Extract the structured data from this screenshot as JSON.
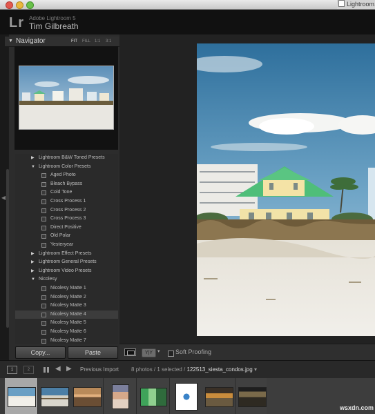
{
  "window": {
    "title": "Lightroom.lr"
  },
  "identity": {
    "logo": "Lr",
    "product": "Adobe Lightroom 5",
    "user": "Tim Gilbreath"
  },
  "navigator": {
    "title": "Navigator",
    "zoom_options": [
      "FIT",
      "FILL",
      "1:1",
      "3:1"
    ]
  },
  "presets": [
    {
      "type": "folder",
      "label": "Lightroom B&W Toned Presets",
      "expanded": false
    },
    {
      "type": "folder",
      "label": "Lightroom Color Presets",
      "expanded": true
    },
    {
      "type": "item",
      "label": "Aged Photo"
    },
    {
      "type": "item",
      "label": "Bleach Bypass"
    },
    {
      "type": "item",
      "label": "Cold Tone"
    },
    {
      "type": "item",
      "label": "Cross Process 1"
    },
    {
      "type": "item",
      "label": "Cross Process 2"
    },
    {
      "type": "item",
      "label": "Cross Process 3"
    },
    {
      "type": "item",
      "label": "Direct Positive"
    },
    {
      "type": "item",
      "label": "Old Polar"
    },
    {
      "type": "item",
      "label": "Yesteryear"
    },
    {
      "type": "folder",
      "label": "Lightroom Effect Presets",
      "expanded": false
    },
    {
      "type": "folder",
      "label": "Lightroom General Presets",
      "expanded": false
    },
    {
      "type": "folder",
      "label": "Lightroom Video Presets",
      "expanded": false
    },
    {
      "type": "folder",
      "label": "Nicolesy",
      "expanded": true
    },
    {
      "type": "item",
      "label": "Nicolesy Matte 1"
    },
    {
      "type": "item",
      "label": "Nicolesy Matte 2"
    },
    {
      "type": "item",
      "label": "Nicolesy Matte 3"
    },
    {
      "type": "item",
      "label": "Nicolesy Matte 4",
      "highlighted": true
    },
    {
      "type": "item",
      "label": "Nicolesy Matte 5"
    },
    {
      "type": "item",
      "label": "Nicolesy Matte 6"
    },
    {
      "type": "item",
      "label": "Nicolesy Matte 7"
    }
  ],
  "buttons": {
    "copy": "Copy...",
    "paste": "Paste"
  },
  "toolbar": {
    "compare": "Y|Y",
    "soft_proofing": "Soft Proofing"
  },
  "filmstrip": {
    "monitor_1": "1",
    "monitor_2": "2",
    "source": "Previous Import",
    "count_prefix": "8 photos / 1 selected /",
    "filename": "122513_siesta_condos.jpg",
    "dropdown": "▾",
    "photos": 8,
    "selected_index": 0
  },
  "watermark": "wsxdn.com"
}
